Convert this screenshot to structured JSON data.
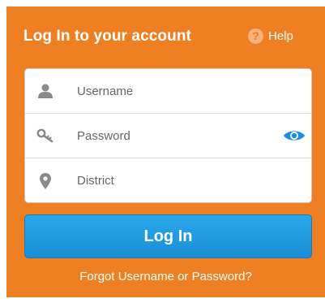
{
  "header": {
    "title": "Log In to your account",
    "help_label": "Help",
    "help_glyph": "?"
  },
  "form": {
    "username_placeholder": "Username",
    "password_placeholder": "Password",
    "district_placeholder": "District"
  },
  "buttons": {
    "login_label": "Log In"
  },
  "links": {
    "forgot_label": "Forgot Username or Password?"
  },
  "icons": {
    "username": "user-icon",
    "password": "key-icon",
    "district": "map-pin-icon",
    "show_password": "eye-icon",
    "help": "question-circle-icon"
  },
  "colors": {
    "panel": "#ee7f22",
    "button": "#1b8ed6",
    "eye": "#1e8fd8",
    "field_icon": "#8a8a8a"
  }
}
